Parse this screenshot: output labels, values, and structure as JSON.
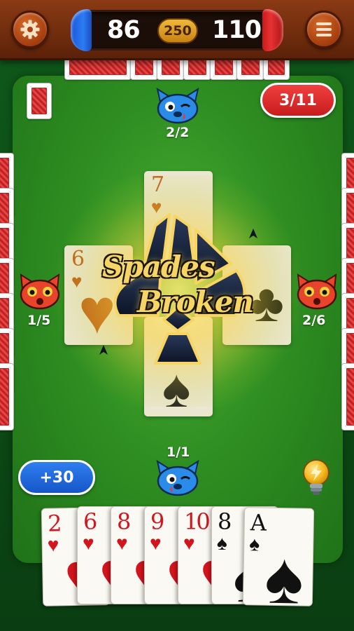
{
  "topbar": {
    "score_blue": "86",
    "target": "250",
    "score_red": "110"
  },
  "round": {
    "label": "3/11"
  },
  "players": {
    "top": {
      "avatar": "blue-cat-avatar",
      "bid": "2/2"
    },
    "left": {
      "avatar": "red-cat-avatar",
      "bid": "1/5"
    },
    "right": {
      "avatar": "red-cat-avatar",
      "bid": "2/6"
    },
    "bottom": {
      "avatar": "blue-cat-avatar",
      "bid": "1/1"
    }
  },
  "trick": {
    "top": {
      "rank": "7",
      "suit": "♥"
    },
    "left": {
      "rank": "6",
      "suit": "♥"
    },
    "right": {
      "rank": "",
      "suit": "♣"
    },
    "bottom": {
      "rank": "",
      "suit": "♠"
    }
  },
  "banner": {
    "line1": "Spades",
    "line2": "Broken"
  },
  "bonus": {
    "label": "+30"
  },
  "hand": [
    {
      "rank": "2",
      "suit": "♥",
      "color": "red"
    },
    {
      "rank": "6",
      "suit": "♥",
      "color": "red"
    },
    {
      "rank": "8",
      "suit": "♥",
      "color": "red"
    },
    {
      "rank": "9",
      "suit": "♥",
      "color": "red"
    },
    {
      "rank": "10",
      "suit": "♥",
      "color": "red"
    },
    {
      "rank": "8",
      "suit": "♠",
      "color": "black"
    },
    {
      "rank": "A",
      "suit": "♠",
      "color": "black"
    }
  ],
  "icons": {
    "settings": "gear-icon",
    "menu": "hamburger-menu-icon",
    "hint": "lightbulb-icon"
  },
  "colors": {
    "team_blue": "#2c7cf4",
    "team_red": "#e63232",
    "felt": "#2f8f22",
    "hearts": "#d4141e"
  }
}
